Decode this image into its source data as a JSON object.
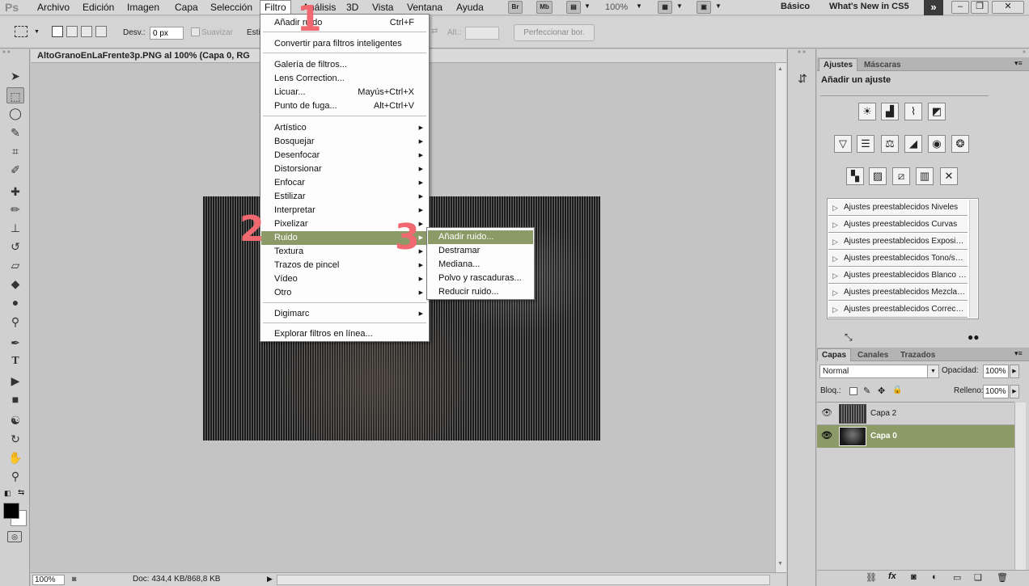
{
  "menubar": {
    "logo": "Ps",
    "items": [
      "Archivo",
      "Edición",
      "Imagen",
      "Capa",
      "Selección",
      "Filtro",
      "Análisis",
      "3D",
      "Vista",
      "Ventana",
      "Ayuda"
    ],
    "bridge_btn": "Br",
    "minibridge_btn": "Mb",
    "zoom": "100%",
    "workspace": "Básico",
    "whats_new": "What's New in CS5"
  },
  "options": {
    "feather_label": "Desv.:",
    "feather_value": "0 px",
    "antialias_label": "Suavizar",
    "style_label": "Esti",
    "height_label": "Alt.:",
    "refine_button": "Perfeccionar bor."
  },
  "document": {
    "tab_title": "AltoGranoEnLaFrente3p.PNG al 100% (Capa 0, RG",
    "status_zoom": "100%",
    "status_doc": "Doc: 434,4 KB/868,8 KB"
  },
  "filter_menu": {
    "items": [
      {
        "label": "Añadir ruido",
        "shortcut": "Ctrl+F"
      },
      {
        "label": "Convertir para filtros inteligentes"
      },
      {
        "label": "Galería de filtros..."
      },
      {
        "label": "Lens Correction..."
      },
      {
        "label": "Licuar...",
        "shortcut": "Mayús+Ctrl+X"
      },
      {
        "label": "Punto de fuga...",
        "shortcut": "Alt+Ctrl+V"
      },
      {
        "label": "Artístico"
      },
      {
        "label": "Bosquejar"
      },
      {
        "label": "Desenfocar"
      },
      {
        "label": "Distorsionar"
      },
      {
        "label": "Enfocar"
      },
      {
        "label": "Estilizar"
      },
      {
        "label": "Interpretar"
      },
      {
        "label": "Pixelizar"
      },
      {
        "label": "Ruido"
      },
      {
        "label": "Textura"
      },
      {
        "label": "Trazos de pincel"
      },
      {
        "label": "Vídeo"
      },
      {
        "label": "Otro"
      },
      {
        "label": "Digimarc"
      },
      {
        "label": "Explorar filtros en línea..."
      }
    ]
  },
  "noise_submenu": {
    "items": [
      "Añadir ruido...",
      "Destramar",
      "Mediana...",
      "Polvo y rascaduras...",
      "Reducir ruido..."
    ]
  },
  "annotations": {
    "step1": "1",
    "step2": "2",
    "step3": "3"
  },
  "adjustments_panel": {
    "tabs": [
      "Ajustes",
      "Máscaras"
    ],
    "title": "Añadir un ajuste",
    "presets": [
      "Ajustes preestablecidos Niveles",
      "Ajustes preestablecidos Curvas",
      "Ajustes preestablecidos Exposición",
      "Ajustes preestablecidos Tono/saturación",
      "Ajustes preestablecidos Blanco y negro",
      "Ajustes preestablecidos Mezclador de canales",
      "Ajustes preestablecidos Corrección selectiva"
    ]
  },
  "layers_panel": {
    "tabs": [
      "Capas",
      "Canales",
      "Trazados"
    ],
    "blend_mode": "Normal",
    "opacity_label": "Opacidad:",
    "opacity_value": "100%",
    "lock_label": "Bloq.:",
    "fill_label": "Relleno:",
    "fill_value": "100%",
    "layers": [
      {
        "name": "Capa 2",
        "selected": false
      },
      {
        "name": "Capa 0",
        "selected": true
      }
    ]
  },
  "colors": {
    "highlight": "#8c9a68",
    "annotation": "#f06870"
  }
}
